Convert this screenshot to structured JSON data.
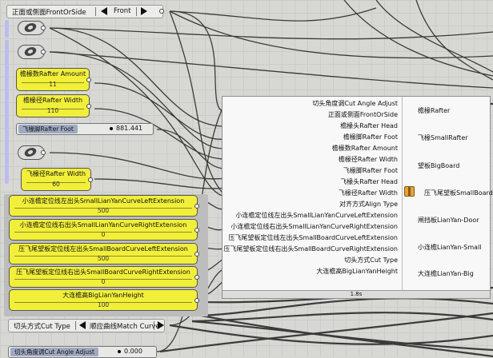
{
  "front_selector": {
    "label": "正面或侧面FrontOrSide",
    "value": "Front"
  },
  "booleans": [
    "toggle-1",
    "toggle-2",
    "toggle-3"
  ],
  "sliders": [
    {
      "title": "檐椽数Rafter Amount",
      "value": "11"
    },
    {
      "title": "檐椽径Rafter Width",
      "value": "110"
    },
    {
      "title": "飞椽径Rafter Width",
      "value": "60"
    },
    {
      "title": "小连檐定位线左出头SmallLianYanCurveLeftExtension",
      "value": "500"
    },
    {
      "title": "小连檐定位线右出头SmallLianYanCurveRightExtension",
      "value": "0"
    },
    {
      "title": "压飞尾望板定位线左出头SmallBoardCurveLeftExtension",
      "value": "500"
    },
    {
      "title": "压飞尾望板定位线右出头SmallBoardCurveRightExtension",
      "value": "0"
    },
    {
      "title": "大连檐高BigLianYanHeight",
      "value": "100"
    }
  ],
  "rafter_foot": {
    "title": "飞椽脚Rafter Foot",
    "value": "881.441"
  },
  "cut_type": {
    "label": "切头方式Cut Type",
    "value": "顺应曲线Match Curve"
  },
  "cut_angle": {
    "title": "切头角度调Cut Angle Adjust",
    "value": "0.000"
  },
  "python_block": {
    "inputs": [
      "切头角度调Cut Angle Adjust",
      "正面或侧面FrontOrSide",
      "檐椽头Rafter Head",
      "檐椽脚Rafter Foot",
      "檐椽数Rafter Amount",
      "檐椽径Rafter Width",
      "飞椽脚Rafter Foot",
      "飞椽头Rafter Head",
      "飞椽径Rafter Width",
      "对齐方式Align Type",
      "小连檐定位线左出头SmallLianYanCurveLeftExtension",
      "小连檐定位线右出头SmallLianYanCurveRightExtension",
      "压飞尾望板定位线左出头SmallBoardCurveLeftExtension",
      "压飞尾望板定位线右出头SmallBoardCurveRightExtension",
      "切头方式Cut Type",
      "大连檐高BigLianYanHeight"
    ],
    "outputs": [
      "檐椽Rafter",
      "飞椽SmallRafter",
      "望板BigBoard",
      "压飞尾望板SmallBoard",
      "闸挡板LianYan-Door",
      "小连檐LianYan-Small",
      "大连檐LianYan-Big"
    ],
    "status": "1.8s"
  }
}
